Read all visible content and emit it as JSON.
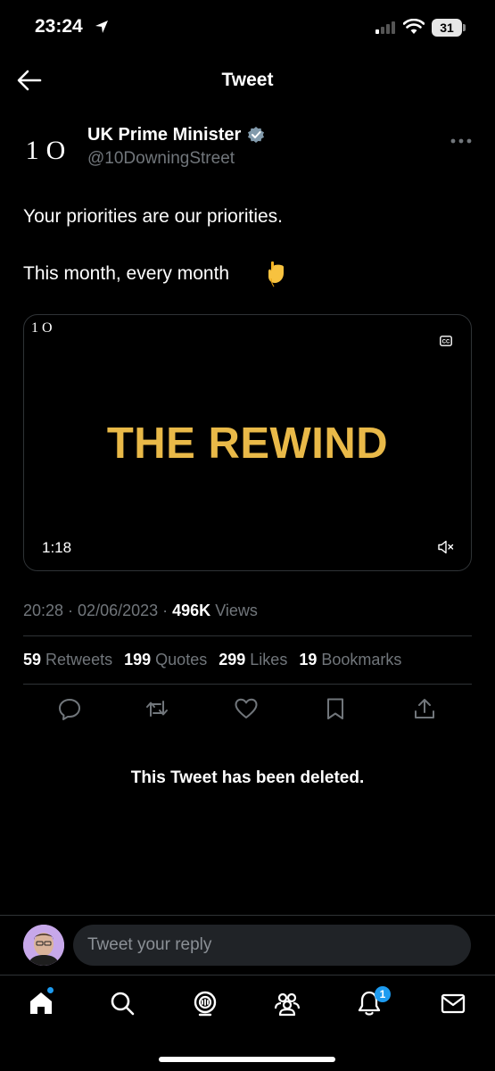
{
  "status_bar": {
    "time": "23:24",
    "battery": "31"
  },
  "header": {
    "title": "Tweet"
  },
  "author": {
    "avatar_text": "1O",
    "name": "UK Prime Minister",
    "handle": "@10DowningStreet"
  },
  "tweet": {
    "line1": "Your priorities are our priorities.",
    "line2": "This month, every month",
    "emoji": "point-down-emoji"
  },
  "media": {
    "logo": "1O",
    "title": "THE REWIND",
    "duration": "1:18",
    "title_color": "#e9b948"
  },
  "meta": {
    "time": "20:28",
    "date": "02/06/2023",
    "views_count": "496K",
    "views_label": "Views"
  },
  "stats": [
    {
      "count": "59",
      "label": "Retweets"
    },
    {
      "count": "199",
      "label": "Quotes"
    },
    {
      "count": "299",
      "label": "Likes"
    },
    {
      "count": "19",
      "label": "Bookmarks"
    }
  ],
  "deleted_notice": "This Tweet has been deleted.",
  "reply": {
    "placeholder": "Tweet your reply"
  },
  "nav": {
    "notifications_badge": "1"
  },
  "colors": {
    "accent": "#1d9bf0",
    "muted": "#71767b",
    "divider": "#2f3336"
  }
}
